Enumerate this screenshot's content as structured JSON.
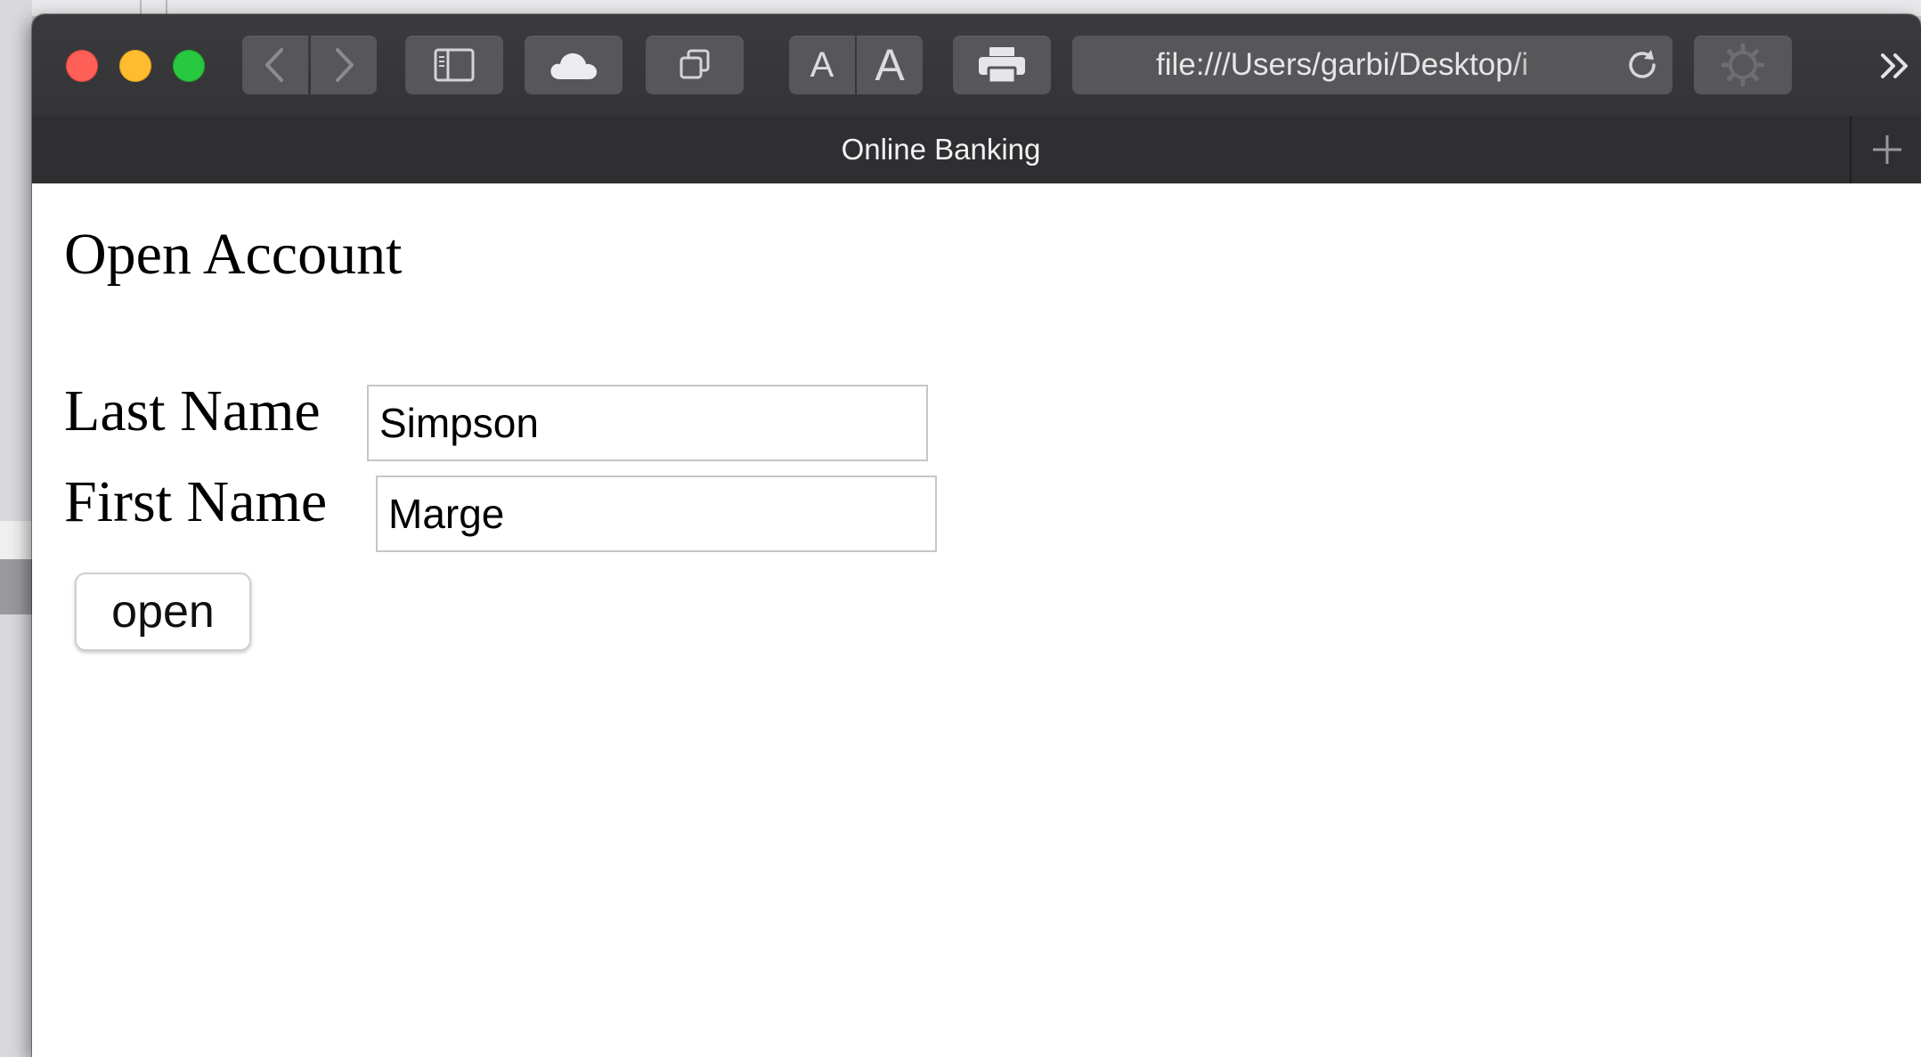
{
  "browser": {
    "address_url": "file:///Users/garbi/Desktop/i",
    "tab_title": "Online Banking",
    "font_small_label": "A",
    "font_large_label": "A"
  },
  "page": {
    "heading": "Open Account",
    "form": {
      "last_name_label": "Last Name",
      "last_name_value": "Simpson",
      "first_name_label": "First Name",
      "first_name_value": "Marge",
      "submit_label": "open"
    }
  },
  "icons": [
    "back-icon",
    "forward-icon",
    "sidebar-icon",
    "cloud-icon",
    "tabs-overview-icon",
    "print-icon",
    "reload-icon",
    "settings-gear-icon",
    "overflow-chevrons-icon",
    "new-tab-plus-icon"
  ],
  "colors": {
    "close": "#fe5f57",
    "minimize": "#febc2e",
    "zoom": "#28c840",
    "toolbar": "#3b3b3d",
    "tab_bar": "#2f2f31"
  }
}
